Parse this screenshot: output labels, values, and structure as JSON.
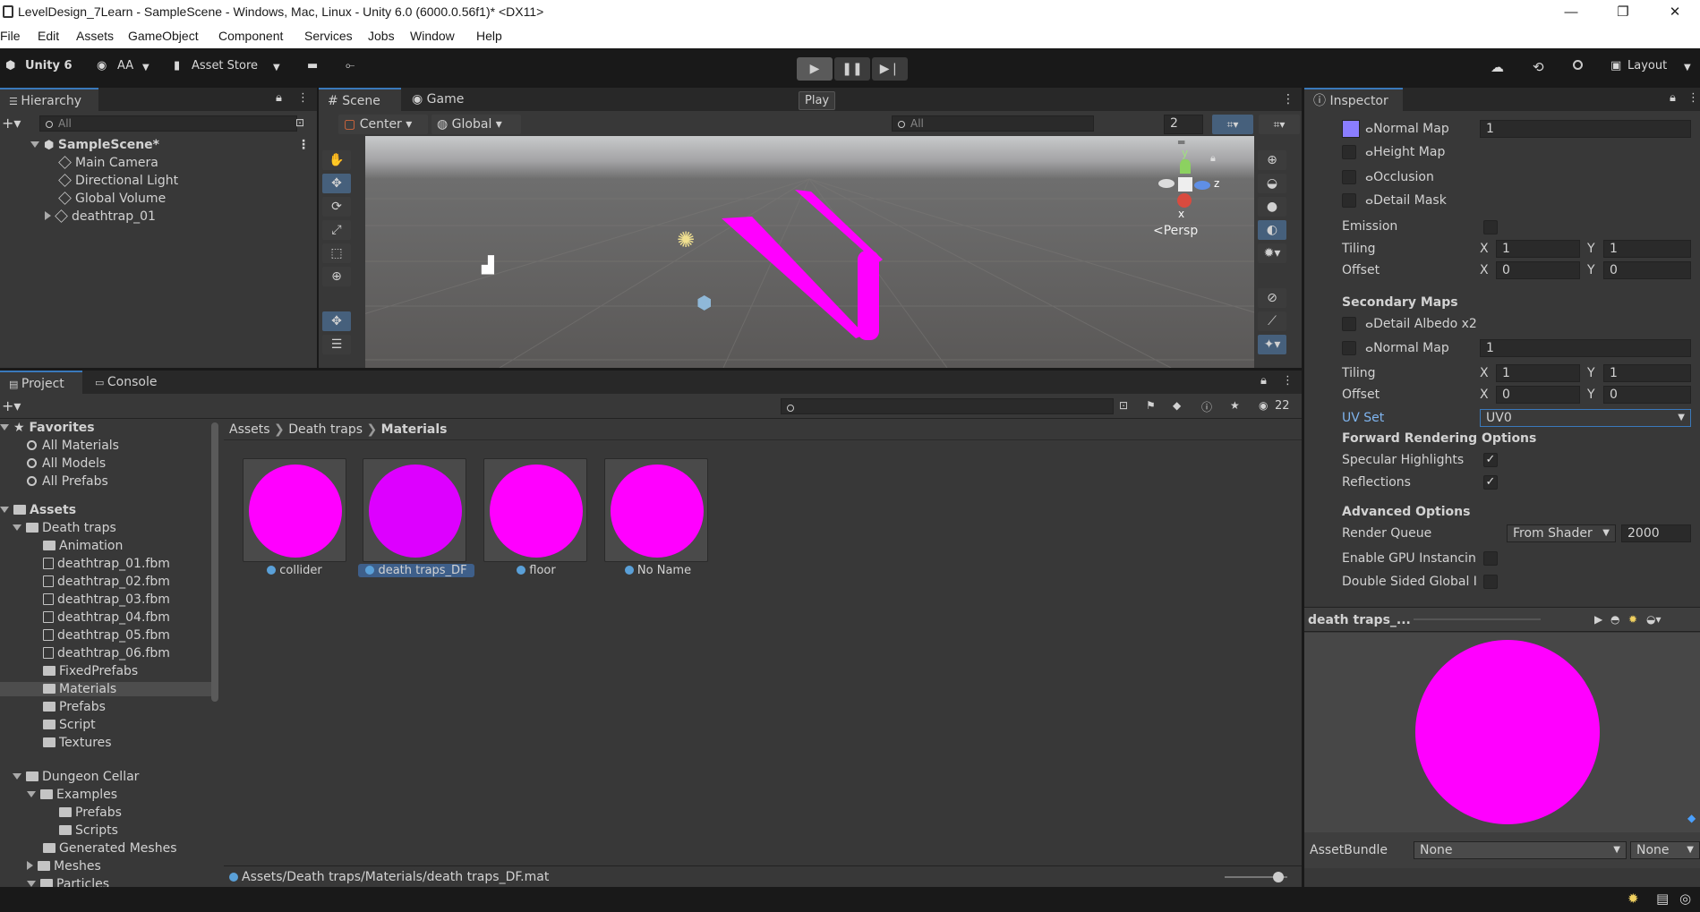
{
  "window": {
    "title": "LevelDesign_7Learn - SampleScene - Windows, Mac, Linux - Unity 6.0 (6000.0.56f1)* <DX11>",
    "minimize": "—",
    "maximize": "❐",
    "close": "✕"
  },
  "menu": [
    "File",
    "Edit",
    "Assets",
    "GameObject",
    "Component",
    "Services",
    "Jobs",
    "Window",
    "Help"
  ],
  "toolbar": {
    "unity": "Unity 6",
    "account": "AA",
    "asset_store": "Asset Store",
    "layout": "Layout",
    "play_tooltip": "Play"
  },
  "hierarchy": {
    "tab": "Hierarchy",
    "search_placeholder": "All",
    "scene": "SampleScene*",
    "items": [
      "Main Camera",
      "Directional Light",
      "Global Volume",
      "deathtrap_01"
    ]
  },
  "scene": {
    "tab_scene": "Scene",
    "tab_game": "Game",
    "pivot": "Center",
    "space": "Global",
    "search_placeholder": "All",
    "grid_value": "2",
    "persp": "Persp",
    "axis_y": "y",
    "axis_z": "z",
    "axis_x": "x"
  },
  "project": {
    "tab_project": "Project",
    "tab_console": "Console",
    "favorites": "Favorites",
    "favorite_items": [
      "All Materials",
      "All Models",
      "All Prefabs"
    ],
    "assets": "Assets",
    "death_traps": "Death traps",
    "death_traps_children": [
      {
        "label": "Animation",
        "kind": "folder"
      },
      {
        "label": "deathtrap_01.fbm",
        "kind": "file"
      },
      {
        "label": "deathtrap_02.fbm",
        "kind": "file"
      },
      {
        "label": "deathtrap_03.fbm",
        "kind": "file"
      },
      {
        "label": "deathtrap_04.fbm",
        "kind": "file"
      },
      {
        "label": "deathtrap_05.fbm",
        "kind": "file"
      },
      {
        "label": "deathtrap_06.fbm",
        "kind": "file"
      },
      {
        "label": "FixedPrefabs",
        "kind": "folder"
      },
      {
        "label": "Materials",
        "kind": "folder"
      },
      {
        "label": "Prefabs",
        "kind": "folder"
      },
      {
        "label": "Script",
        "kind": "folder"
      },
      {
        "label": "Textures",
        "kind": "folder"
      }
    ],
    "dungeon_cellar": "Dungeon Cellar",
    "examples": "Examples",
    "examples_children": [
      "Prefabs",
      "Scripts"
    ],
    "generated_meshes": "Generated Meshes",
    "meshes": "Meshes",
    "particles": "Particles",
    "breadcrumb": [
      "Assets",
      "Death traps",
      "Materials"
    ],
    "hidden_count": "22",
    "materials": [
      {
        "label": "collider",
        "color": "#ff00ff"
      },
      {
        "label": "death traps_DF",
        "color": "#dd00ff"
      },
      {
        "label": "floor",
        "color": "#ff00ff"
      },
      {
        "label": "No Name",
        "color": "#ff00ff"
      }
    ],
    "status_path": "Assets/Death traps/Materials/death traps_DF.mat"
  },
  "inspector": {
    "tab": "Inspector",
    "normal_map": "Normal Map",
    "normal_map_value": "1",
    "height_map": "Height Map",
    "occlusion": "Occlusion",
    "detail_mask": "Detail Mask",
    "emission": "Emission",
    "tiling": "Tiling",
    "offset": "Offset",
    "x": "X",
    "y": "Y",
    "tiling_x": "1",
    "tiling_y": "1",
    "offset_x": "0",
    "offset_y": "0",
    "secondary_maps": "Secondary Maps",
    "detail_albedo": "Detail Albedo x2",
    "normal_map2": "Normal Map",
    "normal_map2_value": "1",
    "tiling2_x": "1",
    "tiling2_y": "1",
    "offset2_x": "0",
    "offset2_y": "0",
    "uv_set": "UV Set",
    "uv_set_value": "UV0",
    "forward_rendering": "Forward Rendering Options",
    "specular": "Specular Highlights",
    "reflections": "Reflections",
    "advanced": "Advanced Options",
    "render_queue": "Render Queue",
    "render_queue_mode": "From Shader",
    "render_queue_value": "2000",
    "gpu_instancing": "Enable GPU Instancin",
    "double_sided": "Double Sided Global I",
    "preview_title": "death traps_...",
    "asset_bundle": "AssetBundle",
    "asset_bundle_value": "None",
    "asset_bundle_variant": "None",
    "accent_color": "#8a7dff",
    "preview_color": "#ff00ff"
  }
}
